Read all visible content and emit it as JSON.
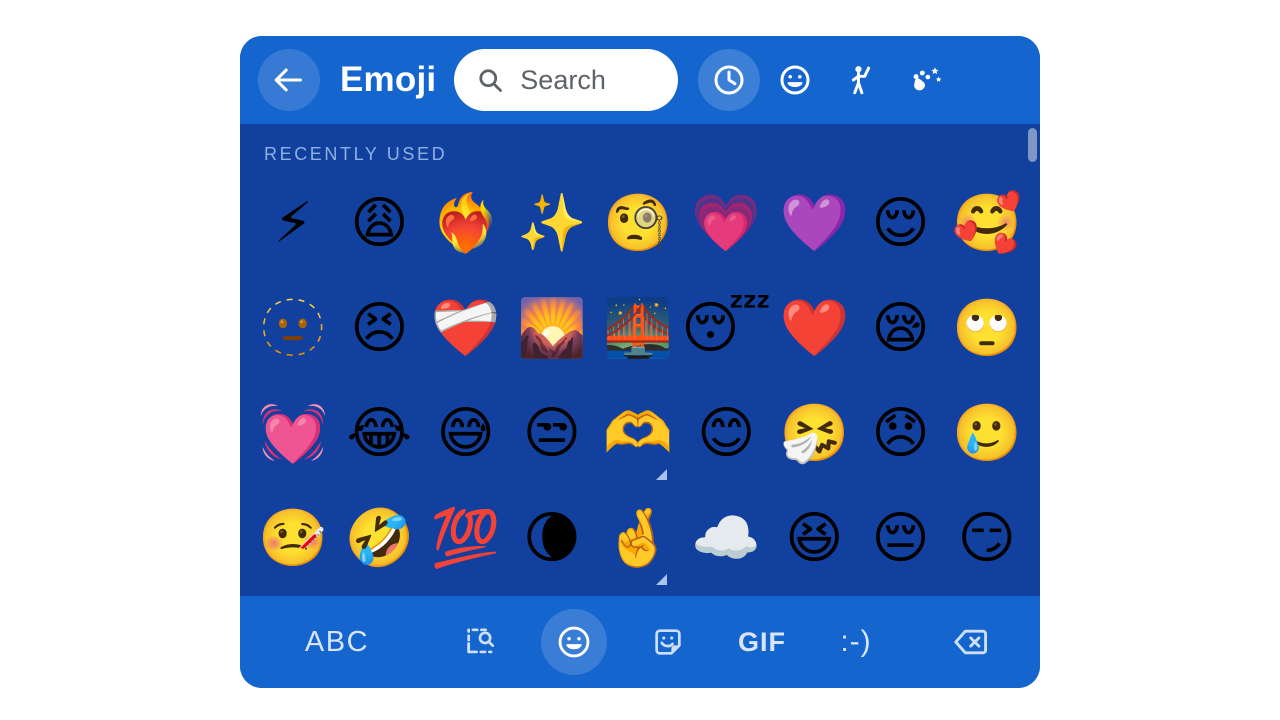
{
  "header": {
    "back_icon": "back-arrow-icon",
    "title": "Emoji",
    "search": {
      "icon": "search-icon",
      "placeholder": "Search"
    },
    "category_tabs": [
      {
        "id": "recent",
        "icon": "clock-icon",
        "label": "Recently used",
        "active": true
      },
      {
        "id": "smileys",
        "icon": "smiley-face-icon",
        "label": "Smileys & emotion",
        "active": false
      },
      {
        "id": "people",
        "icon": "person-waving-icon",
        "label": "People & body",
        "active": false
      },
      {
        "id": "nature",
        "icon": "animals-nature-icon",
        "label": "Animals & nature",
        "active": false
      }
    ]
  },
  "content": {
    "section_label": "RECENTLY USED",
    "scrollbar": {
      "visible": true
    },
    "rows": [
      [
        {
          "char": "⚡",
          "name": "high-voltage"
        },
        {
          "char": "😩",
          "name": "weary-face"
        },
        {
          "char": "❤️‍🔥",
          "name": "heart-on-fire"
        },
        {
          "char": "✨",
          "name": "sparkles"
        },
        {
          "char": "🧐",
          "name": "face-with-monocle"
        },
        {
          "char": "💗",
          "name": "growing-heart"
        },
        {
          "char": "💜",
          "name": "purple-heart"
        },
        {
          "char": "😌",
          "name": "relieved-face"
        },
        {
          "char": "🥰",
          "name": "smiling-face-with-hearts"
        }
      ],
      [
        {
          "char": "🫥",
          "name": "dotted-line-face"
        },
        {
          "char": "😣",
          "name": "persevering-face"
        },
        {
          "char": "❤️‍🩹",
          "name": "mending-heart"
        },
        {
          "char": "🌄",
          "name": "sunrise-over-mountains"
        },
        {
          "char": "🌉",
          "name": "bridge-at-night"
        },
        {
          "char": "😴",
          "name": "sleeping-face"
        },
        {
          "char": "❤️",
          "name": "red-heart"
        },
        {
          "char": "😪",
          "name": "sleepy-face"
        },
        {
          "char": "🙄",
          "name": "face-with-rolling-eyes"
        }
      ],
      [
        {
          "char": "💓",
          "name": "beating-heart"
        },
        {
          "char": "😂",
          "name": "face-with-tears-of-joy"
        },
        {
          "char": "😅",
          "name": "grinning-face-with-sweat"
        },
        {
          "char": "😒",
          "name": "unamused-face"
        },
        {
          "char": "🫶",
          "name": "heart-hands",
          "variant": true
        },
        {
          "char": "😊",
          "name": "smiling-face-with-smiling-eyes"
        },
        {
          "char": "🤧",
          "name": "sneezing-face"
        },
        {
          "char": "😞",
          "name": "disappointed-face"
        },
        {
          "char": "🥲",
          "name": "smiling-face-with-tear"
        }
      ],
      [
        {
          "char": "🤒",
          "name": "face-with-thermometer"
        },
        {
          "char": "🤣",
          "name": "rolling-on-the-floor-laughing"
        },
        {
          "char": "💯",
          "name": "hundred-points"
        },
        {
          "char": "🌘",
          "name": "waning-crescent-moon"
        },
        {
          "char": "🤞",
          "name": "crossed-fingers",
          "variant": true
        },
        {
          "char": "☁️",
          "name": "cloud"
        },
        {
          "char": "😆",
          "name": "grinning-squinting-face"
        },
        {
          "char": "😔",
          "name": "pensive-face"
        },
        {
          "char": "😏",
          "name": "smirking-face"
        }
      ]
    ]
  },
  "bottom_bar": {
    "abc_label": "ABC",
    "buttons": [
      {
        "id": "search-page",
        "icon": "page-search-icon",
        "label": "",
        "active": false
      },
      {
        "id": "emoji",
        "icon": "smiley-face-icon",
        "label": "",
        "active": true
      },
      {
        "id": "sticker",
        "icon": "sticker-icon",
        "label": "",
        "active": false
      },
      {
        "id": "gif",
        "icon": "gif-text-icon",
        "label": "GIF",
        "active": false
      },
      {
        "id": "emoticon",
        "icon": "emoticon-icon",
        "label": ":-)",
        "active": false
      },
      {
        "id": "backspace",
        "icon": "backspace-icon",
        "label": "",
        "active": false
      }
    ]
  },
  "colors": {
    "panel_bg": "#12409e",
    "header_bg": "#1565cf",
    "bottom_bg": "#1565cf",
    "label_text": "#8fb0e2",
    "white": "#ffffff"
  }
}
